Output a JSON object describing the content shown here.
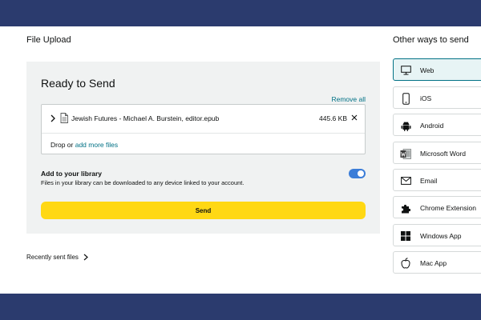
{
  "file_upload": {
    "title": "File Upload"
  },
  "panel": {
    "title": "Ready to Send",
    "remove_all": "Remove all",
    "file": {
      "name": "Jewish Futures - Michael A. Burstein, editor.epub",
      "size": "445.6 KB"
    },
    "drop_text": "Drop or",
    "add_more": "add more files",
    "library": {
      "title": "Add to your library",
      "description": "Files in your library can be downloaded to any device linked to your account.",
      "enabled": true
    },
    "send_label": "Send"
  },
  "recently_sent": "Recently sent files",
  "other_ways": {
    "title": "Other ways to send",
    "items": [
      {
        "label": "Web",
        "icon": "monitor-icon",
        "selected": true
      },
      {
        "label": "iOS",
        "icon": "phone-icon",
        "selected": false
      },
      {
        "label": "Android",
        "icon": "android-icon",
        "selected": false
      },
      {
        "label": "Microsoft Word",
        "icon": "word-icon",
        "selected": false
      },
      {
        "label": "Email",
        "icon": "email-icon",
        "selected": false
      },
      {
        "label": "Chrome Extension",
        "icon": "puzzle-icon",
        "selected": false
      },
      {
        "label": "Windows App",
        "icon": "windows-icon",
        "selected": false
      },
      {
        "label": "Mac App",
        "icon": "apple-icon",
        "selected": false
      }
    ]
  },
  "colors": {
    "frame": "#2b3b6e",
    "link": "#007185",
    "send_button": "#ffd814",
    "toggle": "#3b7dd8",
    "panel": "#f0f2f2"
  }
}
